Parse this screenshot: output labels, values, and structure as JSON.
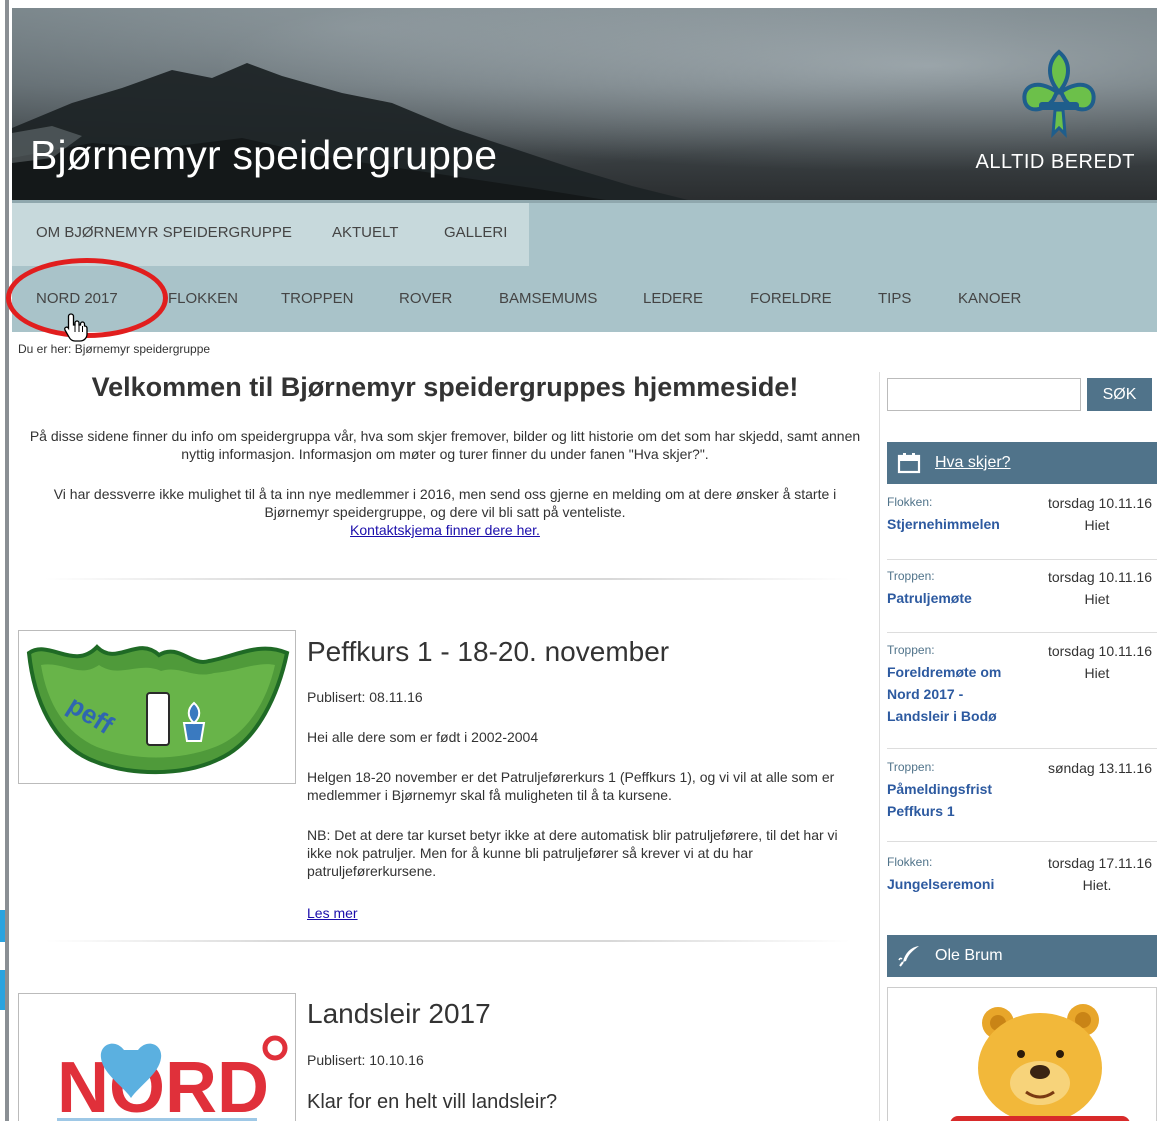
{
  "header": {
    "site_title": "Bjørnemyr speidergruppe",
    "motto": "ALLTID BEREDT"
  },
  "nav": {
    "row1": [
      "OM BJØRNEMYR SPEIDERGRUPPE",
      "AKTUELT",
      "GALLERI"
    ],
    "row2": [
      "NORD 2017",
      "FLOKKEN",
      "TROPPEN",
      "ROVER",
      "BAMSEMUMS",
      "LEDERE",
      "FORELDRE",
      "TIPS",
      "KANOER"
    ]
  },
  "breadcrumb": "Du er her: Bjørnemyr speidergruppe",
  "welcome": {
    "title": "Velkommen til Bjørnemyr speidergruppes hjemmeside!",
    "p1": "På disse sidene finner du info om speidergruppa vår, hva som skjer fremover, bilder og litt historie om det som har skjedd, samt annen nyttig informasjon. Informasjon om møter og turer finner du under fanen \"Hva skjer?\".",
    "p2": "Vi har dessverre ikke mulighet til å ta inn nye medlemmer i 2016, men send oss gjerne en melding om at dere ønsker å starte i Bjørnemyr speidergruppe, og dere vil bli satt på venteliste.",
    "contact_link": "Kontaktskjema finner dere her."
  },
  "articles": [
    {
      "title": "Peffkurs 1 - 18-20. november",
      "published": "Publisert: 08.11.16",
      "p1": "Hei alle dere som er født i 2002-2004",
      "p2": "Helgen 18-20 november er det Patruljeførerkurs 1 (Peffkurs 1), og vi vil at alle som er medlemmer i Bjørnemyr skal få muligheten til å ta kursene.",
      "p3": "NB: Det at dere tar kurset betyr ikke at dere automatisk blir patruljeførere, til det har vi ikke nok patruljer. Men for å kunne bli patruljefører så krever vi at du har patruljeførerkursene.",
      "read_more": "Les mer",
      "badge_text": "peff"
    },
    {
      "title": "Landsleir 2017",
      "published": "Publisert: 10.10.16",
      "lead": "Klar for en helt vill landsleir?",
      "logo_text": "NORD"
    }
  ],
  "search": {
    "placeholder": "",
    "button": "SØK"
  },
  "events_panel": {
    "title": "Hva skjer?",
    "events": [
      {
        "category": "Flokken:",
        "title": "Stjernehimmelen",
        "date": "torsdag 10.11.16",
        "place": "Hiet"
      },
      {
        "category": "Troppen:",
        "title": "Patruljemøte",
        "date": "torsdag 10.11.16",
        "place": "Hiet"
      },
      {
        "category": "Troppen:",
        "title": "Foreldremøte om Nord 2017 - Landsleir i Bodø",
        "date": "torsdag 10.11.16",
        "place": "Hiet"
      },
      {
        "category": "Troppen:",
        "title": "Påmeldingsfrist Peffkurs 1",
        "date": "søndag 13.11.16",
        "place": ""
      },
      {
        "category": "Flokken:",
        "title": "Jungelseremoni",
        "date": "torsdag 17.11.16",
        "place": "Hiet."
      }
    ]
  },
  "pooh_panel": {
    "title": "Ole Brum"
  },
  "colors": {
    "accent": "#50738a",
    "nav_bg": "#a9c3c9",
    "nav_row1_bg": "#c7d9dc",
    "highlight": "#e11e1e",
    "link": "#1a0dab"
  }
}
